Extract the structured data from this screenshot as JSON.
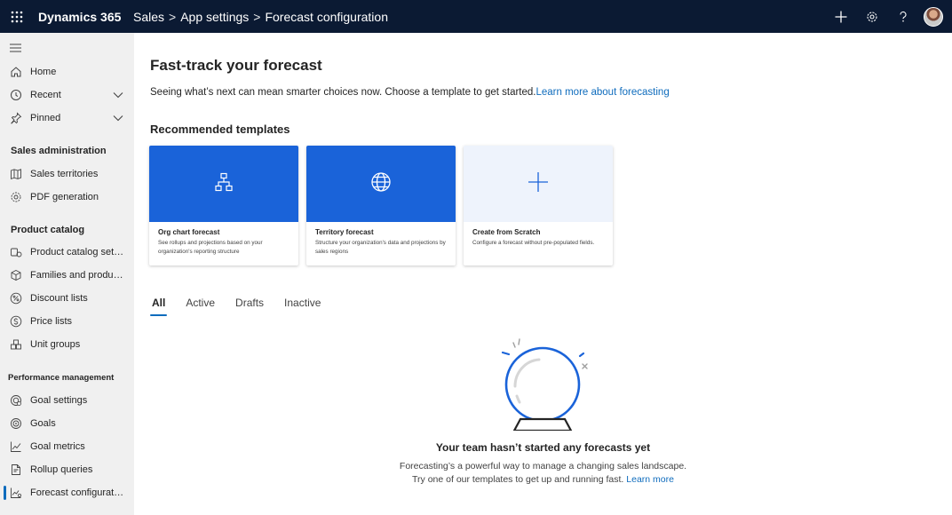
{
  "topbar": {
    "app_name": "Dynamics 365",
    "breadcrumb": [
      "Sales",
      "App settings",
      "Forecast configuration"
    ],
    "separator": ">",
    "icons": [
      "waffle-icon",
      "plus-icon",
      "gear-icon",
      "help-icon",
      "avatar"
    ]
  },
  "sidebar": {
    "top_items": [
      {
        "label": "Home",
        "icon": "home-icon"
      },
      {
        "label": "Recent",
        "icon": "clock-icon",
        "expandable": true
      },
      {
        "label": "Pinned",
        "icon": "pin-icon",
        "expandable": true
      }
    ],
    "groups": [
      {
        "title": "Sales administration",
        "items": [
          {
            "label": "Sales territories",
            "icon": "map-icon"
          },
          {
            "label": "PDF generation",
            "icon": "gear-icon"
          }
        ]
      },
      {
        "title": "Product catalog",
        "items": [
          {
            "label": "Product catalog setti...",
            "icon": "catalog-settings-icon"
          },
          {
            "label": "Families and products",
            "icon": "box-icon"
          },
          {
            "label": "Discount lists",
            "icon": "percent-icon"
          },
          {
            "label": "Price lists",
            "icon": "dollar-icon"
          },
          {
            "label": "Unit groups",
            "icon": "units-icon"
          }
        ]
      },
      {
        "title": "Performance management",
        "items": [
          {
            "label": "Goal settings",
            "icon": "goal-settings-icon"
          },
          {
            "label": "Goals",
            "icon": "target-icon"
          },
          {
            "label": "Goal metrics",
            "icon": "line-chart-icon"
          },
          {
            "label": "Rollup queries",
            "icon": "document-query-icon"
          },
          {
            "label": "Forecast configuration",
            "icon": "forecast-chart-icon",
            "selected": true
          }
        ]
      }
    ]
  },
  "main": {
    "title": "Fast-track your forecast",
    "subtitle": "Seeing what’s next can mean smarter choices now. Choose a template to get started.",
    "subtitle_link": "Learn more about forecasting",
    "templates_title": "Recommended templates",
    "templates": [
      {
        "title": "Org chart forecast",
        "description": "See rollups and projections based on your organization's reporting structure",
        "icon": "org-chart-icon"
      },
      {
        "title": "Territory forecast",
        "description": "Structure your organization's data and projections by sales regions",
        "icon": "globe-icon"
      },
      {
        "title": "Create from Scratch",
        "description": "Configure a forecast without pre-populated fields.",
        "icon": "plus-icon"
      }
    ],
    "tabs": [
      "All",
      "Active",
      "Drafts",
      "Inactive"
    ],
    "active_tab": "All",
    "empty": {
      "title": "Your team hasn’t started any forecasts yet",
      "line1": "Forecasting’s a powerful way to manage a changing sales landscape.",
      "line2": "Try one of our templates to get up and running fast.",
      "link": "Learn more",
      "illustration": "crystal-ball-icon"
    }
  },
  "colors": {
    "topbar_bg": "#0b1a33",
    "accent": "#0f6cbd",
    "template_blue": "#1a63d9",
    "sidebar_bg": "#f0f0f0"
  }
}
